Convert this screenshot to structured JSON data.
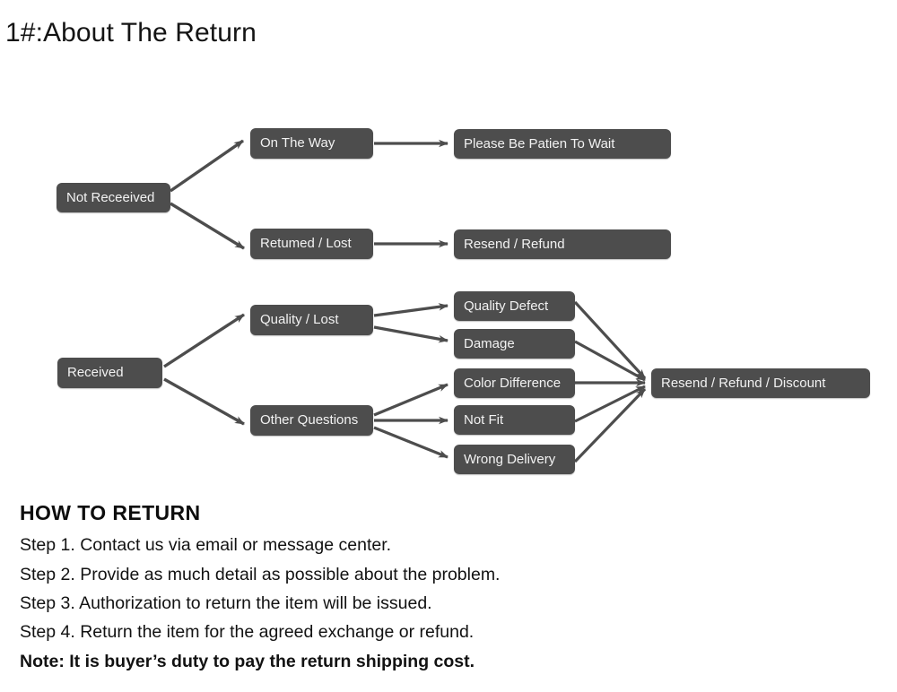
{
  "page": {
    "title": "1#:About The Return",
    "background_color": "#ffffff",
    "node_fill_color": "#4d4d4d",
    "node_text_color": "#f2f2f2",
    "arrow_color": "#4d4d4d",
    "text_color": "#111111"
  },
  "flowchart": {
    "branches": [
      {
        "name": "not-received",
        "root": "Not Receeived",
        "stages": [
          {
            "label": "On The Way",
            "result": "Please Be Patien To Wait"
          },
          {
            "label": "Retumed / Lost",
            "result": "Resend / Refund"
          }
        ]
      },
      {
        "name": "received",
        "root": "Received",
        "stages": [
          {
            "label": "Quality / Lost",
            "reasons": [
              "Quality Defect",
              "Damage"
            ]
          },
          {
            "label": "Other Questions",
            "reasons": [
              "Color Difference",
              "Not Fit",
              "Wrong Delivery"
            ]
          }
        ],
        "result": "Resend / Refund / Discount"
      }
    ],
    "nodes": {
      "not_received": "Not Receeived",
      "on_the_way": "On The Way",
      "returned_lost": "Retumed / Lost",
      "please_wait": "Please Be Patien To Wait",
      "resend_refund": "Resend / Refund",
      "received": "Received",
      "quality_lost": "Quality / Lost",
      "other_questions": "Other Questions",
      "quality_defect": "Quality Defect",
      "damage": "Damage",
      "color_difference": "Color Difference",
      "not_fit": "Not Fit",
      "wrong_delivery": "Wrong Delivery",
      "resend_refund_discount": "Resend / Refund / Discount"
    }
  },
  "howto": {
    "heading": "HOW TO RETURN",
    "steps": [
      "Step 1. Contact us via email or message center.",
      "Step 2. Provide as much detail as possible about the problem.",
      "Step 3. Authorization to return the item will be issued.",
      "Step 4. Return the item for the agreed exchange or refund."
    ],
    "note": "Note: It is buyer’s duty to pay the return shipping cost."
  }
}
